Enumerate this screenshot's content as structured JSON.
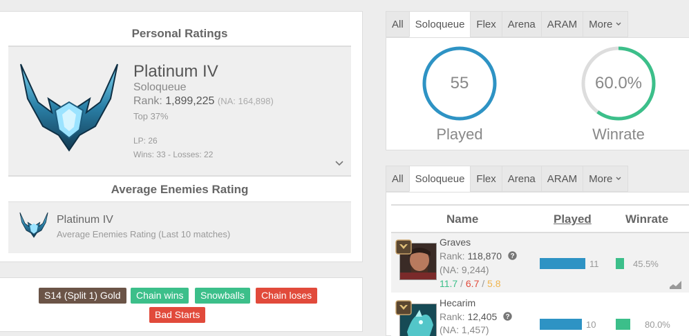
{
  "personal": {
    "title": "Personal Ratings",
    "rank_name": "Platinum IV",
    "queue": "Soloqueue",
    "rank_label": "Rank:",
    "rank_value": "1,899,225",
    "rank_na": "(NA: 164,898)",
    "top": "Top 37%",
    "lp": "LP: 26",
    "wins_losses": "Wins: 33 - Losses: 22"
  },
  "average": {
    "title": "Average Enemies Rating",
    "rank_name": "Platinum IV",
    "subtitle": "Average Enemies Rating (Last 10 matches)"
  },
  "tags": [
    {
      "label": "S14 (Split 1) Gold",
      "color": "#6b5447"
    },
    {
      "label": "Chain wins",
      "color": "#3cbf8a"
    },
    {
      "label": "Snowballs",
      "color": "#3cbf8a"
    },
    {
      "label": "Chain loses",
      "color": "#e14a3b"
    },
    {
      "label": "Bad Starts",
      "color": "#e14a3b"
    }
  ],
  "tabs_top": [
    "All",
    "Soloqueue",
    "Flex",
    "Arena",
    "ARAM",
    "More"
  ],
  "tabs_bottom": [
    "All",
    "Soloqueue",
    "Flex",
    "Arena",
    "ARAM",
    "More"
  ],
  "stats": {
    "played_value": "55",
    "played_label": "Played",
    "winrate_value": "60.0%",
    "winrate_label": "Winrate",
    "winrate_fraction": 0.6
  },
  "table": {
    "headers": {
      "name": "Name",
      "played": "Played",
      "winrate": "Winrate"
    },
    "rows": [
      {
        "name": "Graves",
        "rank_label": "Rank:",
        "rank": "118,870",
        "na": "(NA: 9,244)",
        "kills": "11.7",
        "deaths": "6.7",
        "assists": "5.8",
        "played": "11",
        "played_fraction": 0.6,
        "winrate": "45.5%",
        "winrate_fraction": 0.455
      },
      {
        "name": "Hecarim",
        "rank_label": "Rank:",
        "rank": "12,405",
        "na": "(NA: 1,457)",
        "played": "10",
        "played_fraction": 0.55,
        "winrate": "80.0%",
        "winrate_fraction": 0.8
      }
    ]
  },
  "colors": {
    "played_ring": "#2e93c4",
    "winrate_ring": "#3cbf8a",
    "kills": "#3cbf8a",
    "deaths": "#e14a3b",
    "assists": "#f0b44c"
  },
  "icons": [
    "platinum-emblem-icon",
    "chevron-down-icon",
    "help-icon",
    "trend-chart-icon",
    "rank-badge-icon"
  ]
}
